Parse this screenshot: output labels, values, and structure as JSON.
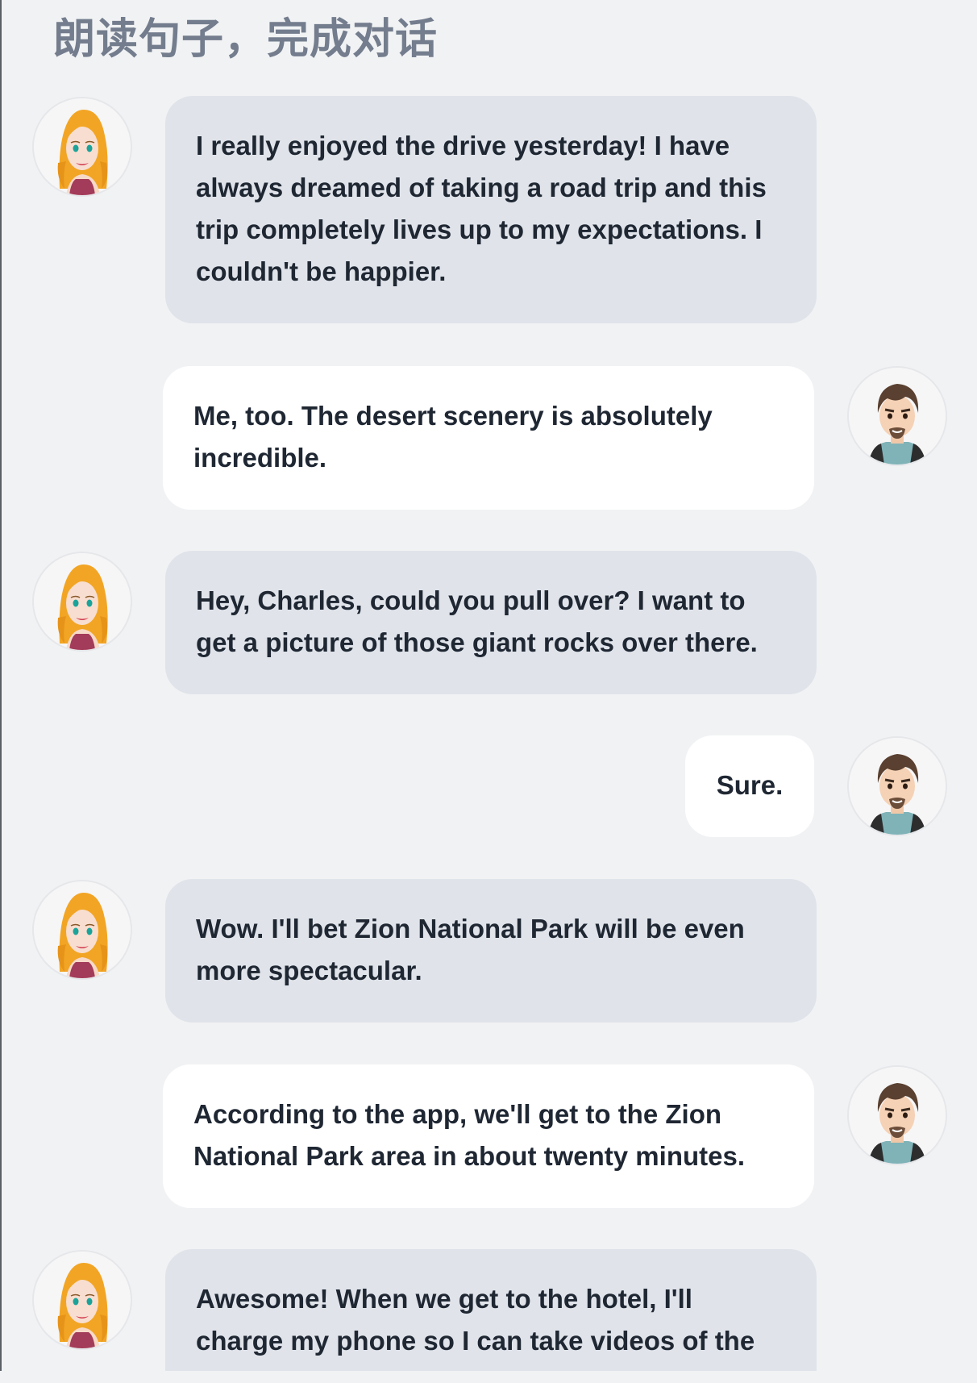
{
  "title": "朗读句子，完成对话",
  "messages": [
    {
      "speaker": "female",
      "text": "I really enjoyed the drive yesterday! I have always dreamed of taking a road trip and this trip completely lives up to my expectations. I couldn't be happier."
    },
    {
      "speaker": "male",
      "text": "Me, too. The desert scenery is absolutely incredible."
    },
    {
      "speaker": "female",
      "text": "Hey, Charles, could you pull over? I want to get a picture of those giant rocks over there."
    },
    {
      "speaker": "male",
      "text": "Sure."
    },
    {
      "speaker": "female",
      "text": "Wow. I'll bet Zion National Park will be even more spectacular."
    },
    {
      "speaker": "male",
      "text": "According to the app, we'll get to the Zion National Park area in about twenty minutes."
    },
    {
      "speaker": "female",
      "text": "Awesome! When we get to the hotel, I'll charge my phone so I can take videos of the"
    }
  ],
  "avatars": {
    "female": "female-avatar-icon",
    "male": "male-avatar-icon"
  },
  "colors": {
    "background": "#f1f2f4",
    "female_bubble": "#e0e4ea",
    "male_bubble": "#ffffff",
    "title": "#737d8d",
    "text": "#1f2733"
  }
}
